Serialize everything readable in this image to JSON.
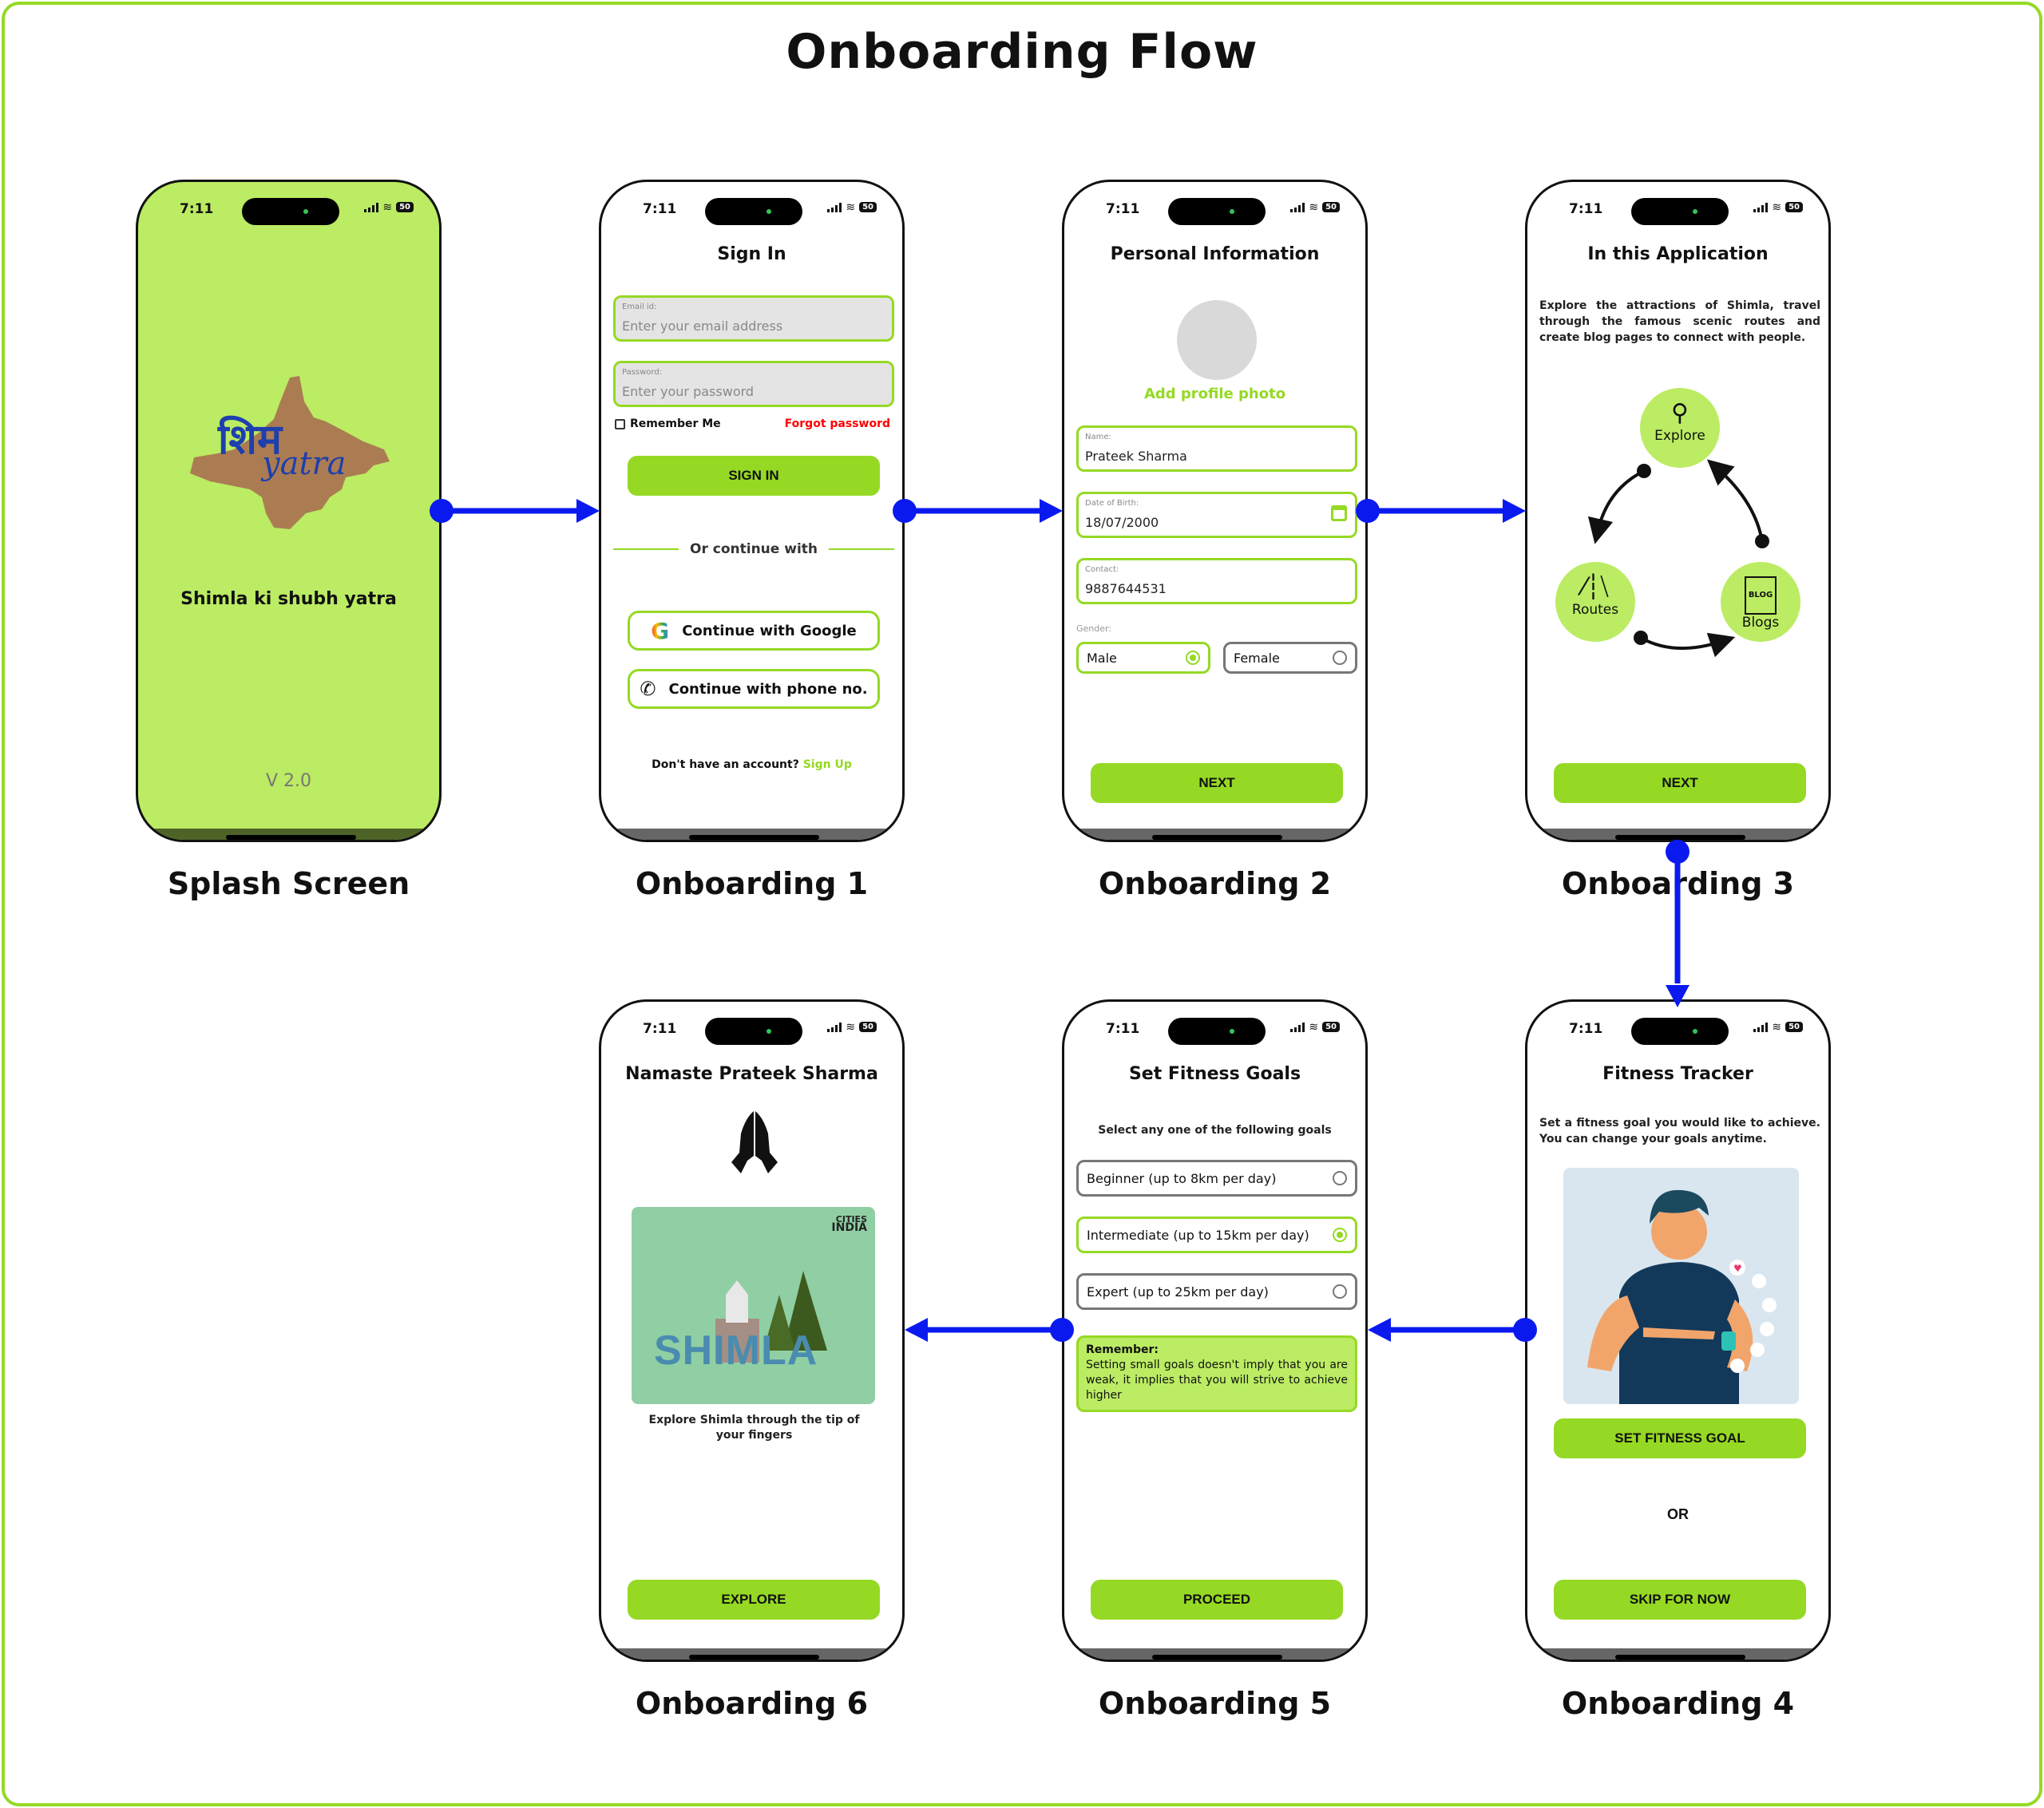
{
  "title": "Onboarding Flow",
  "colors": {
    "accent": "#95d924",
    "accent_light": "#bbec63",
    "connector": "#0a1aef",
    "danger": "#ff0000"
  },
  "status_bar": {
    "time": "7:11",
    "battery": "50"
  },
  "screens": {
    "splash": {
      "label": "Splash Screen",
      "logo_hindi": "शिम",
      "logo_script": "yatra",
      "tagline": "Shimla ki shubh yatra",
      "version": "V 2.0"
    },
    "onboarding1": {
      "label": "Onboarding 1",
      "title": "Sign In",
      "email_label": "Email id:",
      "email_placeholder": "Enter your email address",
      "password_label": "Password:",
      "password_placeholder": "Enter your password",
      "remember_me": "Remember Me",
      "remember_checked": false,
      "forgot_password": "Forgot password",
      "sign_in_button": "SIGN IN",
      "divider_text": "Or continue with",
      "google_button": "Continue with Google",
      "phone_button": "Continue with phone no.",
      "no_account_text": "Don't have an account?",
      "sign_up_link": "Sign Up"
    },
    "onboarding2": {
      "label": "Onboarding 2",
      "title": "Personal Information",
      "add_photo": "Add profile photo",
      "name_label": "Name:",
      "name_value": "Prateek Sharma",
      "dob_label": "Date of Birth:",
      "dob_value": "18/07/2000",
      "contact_label": "Contact:",
      "contact_value": "9887644531",
      "gender_label": "Gender:",
      "gender_options": [
        "Male",
        "Female"
      ],
      "gender_selected": "Male",
      "next_button": "NEXT"
    },
    "onboarding3": {
      "label": "Onboarding 3",
      "title": "In this Application",
      "description": "Explore the attractions of Shimla, travel through the famous scenic routes and create blog pages to connect with people.",
      "features": [
        "Explore",
        "Routes",
        "Blogs"
      ],
      "blog_icon_text": "BLOG",
      "next_button": "NEXT"
    },
    "onboarding4": {
      "label": "Onboarding 4",
      "title": "Fitness Tracker",
      "description": "Set a fitness goal you would like to achieve. You can change your goals anytime.",
      "set_goal_button": "SET FITNESS GOAL",
      "or_text": "OR",
      "skip_button": "SKIP FOR NOW"
    },
    "onboarding5": {
      "label": "Onboarding 5",
      "title": "Set Fitness Goals",
      "subtitle": "Select any one of the following goals",
      "goals": [
        "Beginner (up to 8km per day)",
        "Intermediate (up to 15km per day)",
        "Expert (up to 25km per day)"
      ],
      "selected_goal": "Intermediate (up to 15km per day)",
      "remember_title": "Remember:",
      "remember_text": "Setting small goals doesn't imply that you are weak, it implies that you will strive to achieve higher",
      "proceed_button": "PROCEED"
    },
    "onboarding6": {
      "label": "Onboarding 6",
      "title": "Namaste Prateek Sharma",
      "banner_brand_top": "CITIES",
      "banner_brand_bottom": "INDIA",
      "banner_text": "SHIMLA",
      "caption": "Explore Shimla through the tip of your fingers",
      "explore_button": "EXPLORE"
    }
  },
  "flow": [
    [
      "Splash Screen",
      "Onboarding 1"
    ],
    [
      "Onboarding 1",
      "Onboarding 2"
    ],
    [
      "Onboarding 2",
      "Onboarding 3"
    ],
    [
      "Onboarding 3",
      "Onboarding 4"
    ],
    [
      "Onboarding 4",
      "Onboarding 5"
    ],
    [
      "Onboarding 5",
      "Onboarding 6"
    ]
  ]
}
